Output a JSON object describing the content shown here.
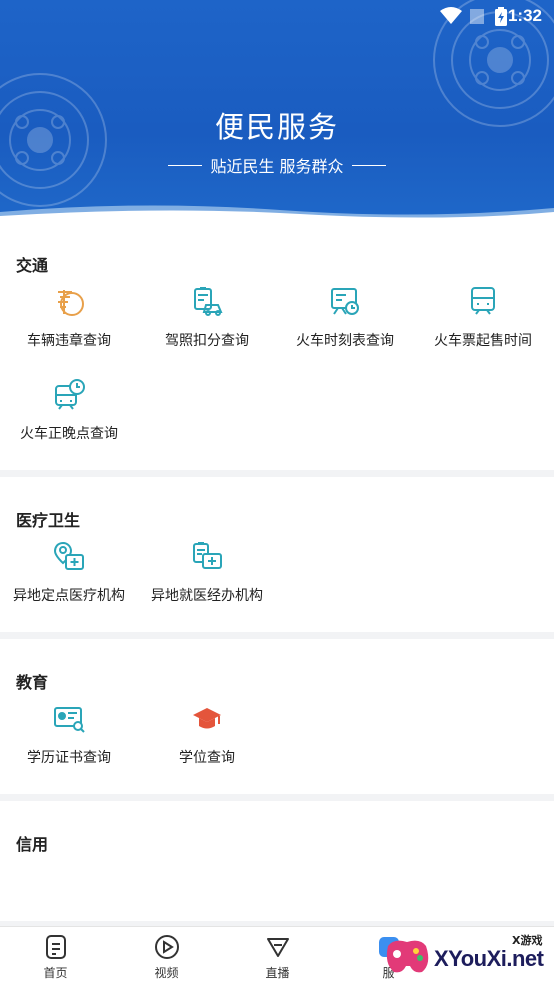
{
  "status_bar": {
    "time": "1:32"
  },
  "header": {
    "title": "便民服务",
    "subtitle": "贴近民生 服务群众"
  },
  "sections": [
    {
      "title": "交通",
      "items": [
        {
          "label": "车辆违章查询",
          "icon": "violation-icon"
        },
        {
          "label": "驾照扣分查询",
          "icon": "license-points-icon"
        },
        {
          "label": "火车时刻表查询",
          "icon": "train-schedule-icon"
        },
        {
          "label": "火车票起售时间",
          "icon": "train-ticket-icon"
        },
        {
          "label": "火车正晚点查询",
          "icon": "train-delay-icon"
        }
      ]
    },
    {
      "title": "医疗卫生",
      "items": [
        {
          "label": "异地定点医疗机构",
          "icon": "medical-location-icon"
        },
        {
          "label": "异地就医经办机构",
          "icon": "medical-office-icon"
        }
      ]
    },
    {
      "title": "教育",
      "items": [
        {
          "label": "学历证书查询",
          "icon": "certificate-icon"
        },
        {
          "label": "学位查询",
          "icon": "graduation-cap-icon"
        }
      ]
    },
    {
      "title": "信用",
      "items": []
    }
  ],
  "tabbar": [
    {
      "label": "首页",
      "icon": "home-doc-icon"
    },
    {
      "label": "视频",
      "icon": "video-play-icon"
    },
    {
      "label": "直播",
      "icon": "live-tv-icon"
    },
    {
      "label": "服",
      "icon": "service-icon"
    }
  ],
  "watermark": {
    "site": "XYouXi.net",
    "cn": "X游戏"
  },
  "colors": {
    "header_blue": "#1e64c8",
    "icon_teal": "#2aa5b8",
    "icon_orange": "#e8a04a",
    "icon_red": "#e4553b"
  }
}
